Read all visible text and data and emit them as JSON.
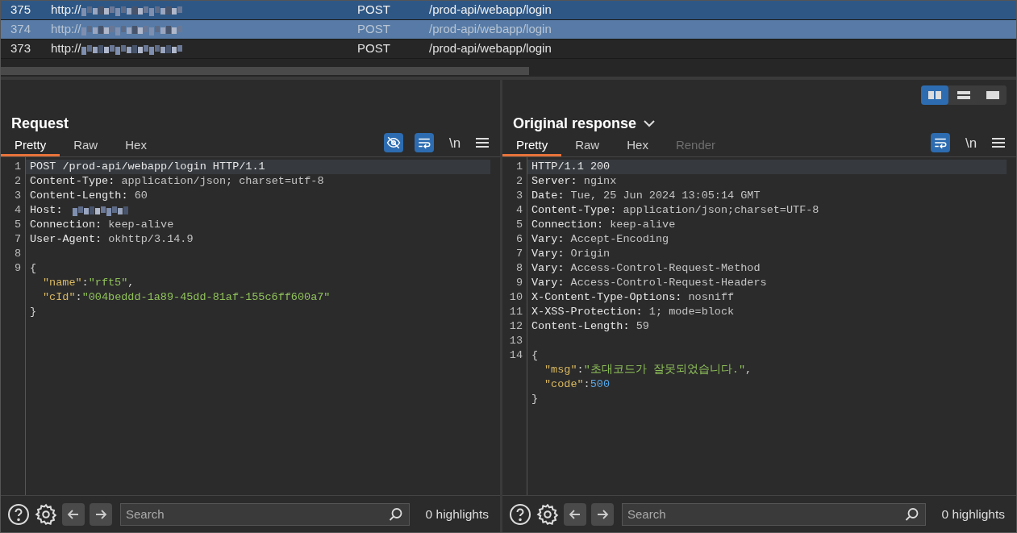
{
  "history": {
    "rows": [
      {
        "number": "375",
        "url": "http://",
        "method": "POST",
        "path": "/prod-api/webapp/login",
        "selected": true
      },
      {
        "number": "374",
        "url": "http://",
        "method": "POST",
        "path": "/prod-api/webapp/login",
        "selected": false,
        "color": "#577ba6"
      },
      {
        "number": "373",
        "url": "http://",
        "method": "POST",
        "path": "/prod-api/webapp/login",
        "selected": false
      }
    ]
  },
  "view_toggles": [
    {
      "kind": "columns",
      "selected": true
    },
    {
      "kind": "rows",
      "selected": false
    },
    {
      "kind": "single",
      "selected": false
    }
  ],
  "panels": [
    {
      "title": "Request",
      "dropdown": false,
      "tabs": [
        {
          "label": "Pretty",
          "selected": true,
          "disabled": false
        },
        {
          "label": "Raw",
          "selected": false,
          "disabled": false
        },
        {
          "label": "Hex",
          "selected": false,
          "disabled": false
        }
      ],
      "toolbar": [
        {
          "kind": "hide",
          "on": true
        },
        {
          "kind": "wrap",
          "on": true
        },
        {
          "kind": "text",
          "label": "\\n"
        },
        {
          "kind": "menu"
        }
      ],
      "lines": [
        {
          "number": "1",
          "tokens": [
            {
              "kind": "name",
              "text": "POST /prod-api/webapp/login HTTP/1.1"
            }
          ]
        },
        {
          "number": "2",
          "tokens": [
            {
              "kind": "name",
              "text": "Content-Type:"
            },
            {
              "kind": "value",
              "text": " application/json; charset=utf-8"
            }
          ]
        },
        {
          "number": "3",
          "tokens": [
            {
              "kind": "name",
              "text": "Content-Length:"
            },
            {
              "kind": "value",
              "text": " 60"
            }
          ]
        },
        {
          "number": "4",
          "tokens": [
            {
              "kind": "name",
              "text": "Host:"
            },
            {
              "kind": "redacted"
            }
          ]
        },
        {
          "number": "5",
          "tokens": [
            {
              "kind": "name",
              "text": "Connection:"
            },
            {
              "kind": "value",
              "text": " keep-alive"
            }
          ]
        },
        {
          "number": "7",
          "tokens": [
            {
              "kind": "name",
              "text": "User-Agent:"
            },
            {
              "kind": "value",
              "text": " okhttp/3.14.9"
            }
          ]
        },
        {
          "number": "8"
        },
        {
          "number": "9",
          "tokens": [
            {
              "kind": "punct",
              "text": "{"
            }
          ]
        },
        {
          "tokens": [
            {
              "kind": "key",
              "text": "\"name\""
            },
            {
              "kind": "punct",
              "text": ":"
            },
            {
              "kind": "string",
              "text": "\"rft5\""
            },
            {
              "kind": "punct",
              "text": ","
            }
          ]
        },
        {
          "tokens": [
            {
              "kind": "key",
              "text": "\"cId\""
            },
            {
              "kind": "punct",
              "text": ":"
            },
            {
              "kind": "string",
              "text": "\"004beddd-1a89-45dd-81af-155c6ff600a7\""
            }
          ]
        },
        {
          "tokens": [
            {
              "kind": "punct",
              "text": "}"
            }
          ]
        }
      ],
      "search": {
        "placeholder": "Search"
      },
      "highlights": "0 highlights"
    },
    {
      "title": "Original response",
      "dropdown": true,
      "tabs": [
        {
          "label": "Pretty",
          "selected": true,
          "disabled": false
        },
        {
          "label": "Raw",
          "selected": false,
          "disabled": false
        },
        {
          "label": "Hex",
          "selected": false,
          "disabled": false
        },
        {
          "label": "Render",
          "selected": false,
          "disabled": true
        }
      ],
      "toolbar": [
        {
          "kind": "wrap",
          "on": true
        },
        {
          "kind": "text",
          "label": "\\n"
        },
        {
          "kind": "menu"
        }
      ],
      "lines": [
        {
          "number": "1",
          "tokens": [
            {
              "kind": "name",
              "text": "HTTP/1.1 200"
            }
          ]
        },
        {
          "number": "2",
          "tokens": [
            {
              "kind": "name",
              "text": "Server:"
            },
            {
              "kind": "value",
              "text": " nginx"
            }
          ]
        },
        {
          "number": "3",
          "tokens": [
            {
              "kind": "name",
              "text": "Date:"
            },
            {
              "kind": "value",
              "text": " Tue, 25 Jun 2024 13:05:14 GMT"
            }
          ]
        },
        {
          "number": "4",
          "tokens": [
            {
              "kind": "name",
              "text": "Content-Type:"
            },
            {
              "kind": "value",
              "text": " application/json;charset=UTF-8"
            }
          ]
        },
        {
          "number": "5",
          "tokens": [
            {
              "kind": "name",
              "text": "Connection:"
            },
            {
              "kind": "value",
              "text": " keep-alive"
            }
          ]
        },
        {
          "number": "6",
          "tokens": [
            {
              "kind": "name",
              "text": "Vary:"
            },
            {
              "kind": "value",
              "text": " Accept-Encoding"
            }
          ]
        },
        {
          "number": "7",
          "tokens": [
            {
              "kind": "name",
              "text": "Vary:"
            },
            {
              "kind": "value",
              "text": " Origin"
            }
          ]
        },
        {
          "number": "8",
          "tokens": [
            {
              "kind": "name",
              "text": "Vary:"
            },
            {
              "kind": "value",
              "text": " Access-Control-Request-Method"
            }
          ]
        },
        {
          "number": "9",
          "tokens": [
            {
              "kind": "name",
              "text": "Vary:"
            },
            {
              "kind": "value",
              "text": " Access-Control-Request-Headers"
            }
          ]
        },
        {
          "number": "10",
          "tokens": [
            {
              "kind": "name",
              "text": "X-Content-Type-Options:"
            },
            {
              "kind": "value",
              "text": " nosniff"
            }
          ]
        },
        {
          "number": "11",
          "tokens": [
            {
              "kind": "name",
              "text": "X-XSS-Protection:"
            },
            {
              "kind": "value",
              "text": " 1; mode=block"
            }
          ]
        },
        {
          "number": "12",
          "tokens": [
            {
              "kind": "name",
              "text": "Content-Length:"
            },
            {
              "kind": "value",
              "text": " 59"
            }
          ]
        },
        {
          "number": "13"
        },
        {
          "number": "14",
          "tokens": [
            {
              "kind": "punct",
              "text": "{"
            }
          ]
        },
        {
          "tokens": [
            {
              "kind": "key",
              "text": "\"msg\""
            },
            {
              "kind": "punct",
              "text": ":"
            },
            {
              "kind": "string",
              "text": "\"초대코드가 잘못되었습니다.\""
            },
            {
              "kind": "punct",
              "text": ","
            }
          ]
        },
        {
          "tokens": [
            {
              "kind": "key",
              "text": "\"code\""
            },
            {
              "kind": "punct",
              "text": ":"
            },
            {
              "kind": "number",
              "text": "500"
            }
          ]
        },
        {
          "tokens": [
            {
              "kind": "punct",
              "text": "}"
            }
          ]
        }
      ],
      "search": {
        "placeholder": "Search"
      },
      "highlights": "0 highlights"
    }
  ]
}
